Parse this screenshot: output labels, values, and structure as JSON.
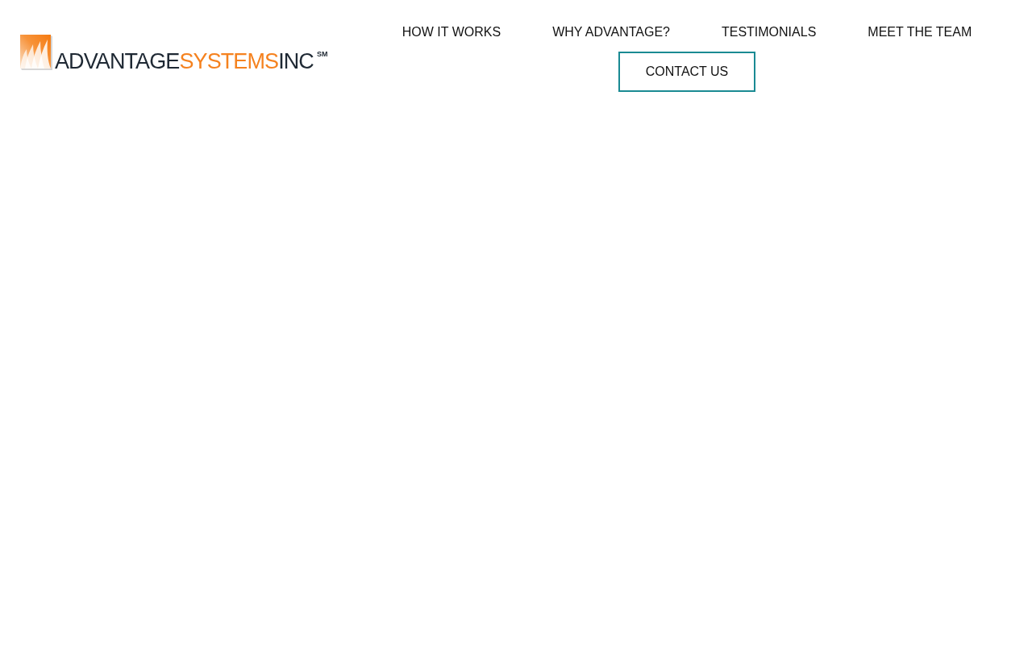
{
  "logo": {
    "words": [
      {
        "text": "ADVANTAGE",
        "color": "#1e2833"
      },
      {
        "text": "SYSTEMS",
        "color": "#f5821f"
      },
      {
        "text": "INC",
        "color": "#1e2833"
      }
    ],
    "service_mark": "SM"
  },
  "nav": {
    "items": [
      {
        "label": "HOW IT WORKS"
      },
      {
        "label": "WHY ADVANTAGE?"
      },
      {
        "label": "TESTIMONIALS"
      },
      {
        "label": "MEET THE TEAM"
      }
    ]
  },
  "contact_button": {
    "label": "CONTACT US"
  }
}
